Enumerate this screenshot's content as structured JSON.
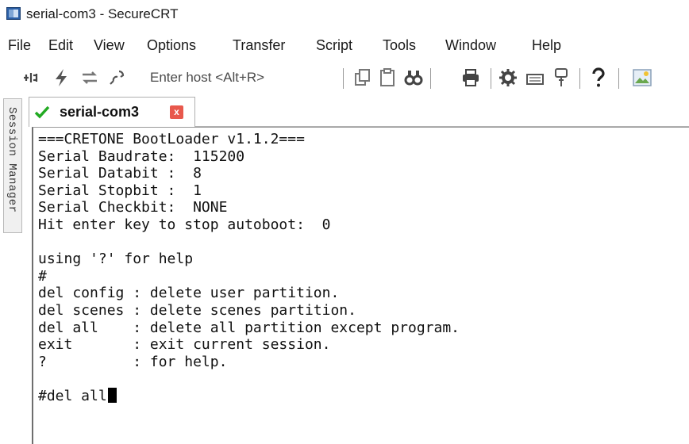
{
  "window": {
    "title": "serial-com3 - SecureCRT"
  },
  "menu": [
    "File",
    "Edit",
    "View",
    "Options",
    "Transfer",
    "Script",
    "Tools",
    "Window",
    "Help"
  ],
  "toolbar": {
    "host_placeholder": "Enter host <Alt+R>",
    "icons": [
      "connect-icon",
      "quick-connect-icon",
      "reconnect-icon",
      "disconnect-icon",
      "copy-icon",
      "paste-icon",
      "find-icon",
      "print-icon",
      "settings-icon",
      "keymap-icon",
      "sftp-icon",
      "help-icon",
      "screenshot-icon"
    ]
  },
  "session_manager": {
    "label": "Session Manager"
  },
  "tab": {
    "label": "serial-com3",
    "close": "x",
    "status_color": "#22aa22"
  },
  "terminal": {
    "lines": [
      "===CRETONE BootLoader v1.1.2===",
      "Serial Baudrate:  115200",
      "Serial Databit :  8",
      "Serial Stopbit :  1",
      "Serial Checkbit:  NONE",
      "Hit enter key to stop autoboot:  0",
      "",
      "using '?' for help",
      "#",
      "del config : delete user partition.",
      "del scenes : delete scenes partition.",
      "del all    : delete all partition except program.",
      "exit       : exit current session.",
      "?          : for help.",
      "",
      "#del all"
    ]
  }
}
